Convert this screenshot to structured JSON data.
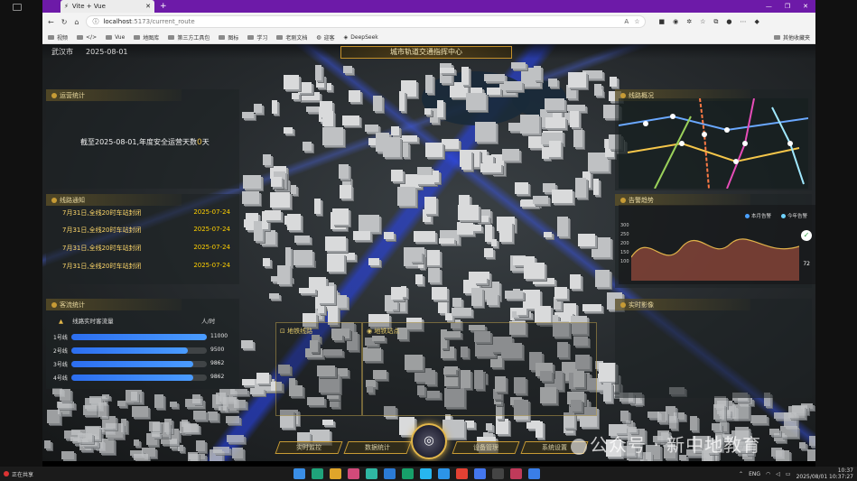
{
  "browser": {
    "tab_title": "Vite + Vue",
    "url_host": "localhost",
    "url_path": ":5173/current_route",
    "bookmarks": [
      "视频",
      "</>",
      "Vue",
      "地图库",
      "第三方工具包",
      "图标",
      "学习",
      "老刚文档",
      "迎客",
      "DeepSeek"
    ],
    "bookmarks_right": "其他收藏夹"
  },
  "dashboard": {
    "city": "武汉市",
    "date": "2025-08-01",
    "title": "城市轨道交通指挥中心",
    "panels": {
      "safety": "运营统计",
      "notice": "线路通知",
      "flow": "客流统计",
      "metro": "线路概况",
      "alarm": "告警趋势",
      "media": "实时影像",
      "lines": "地铁线路",
      "stations": "地铁站点"
    },
    "safety_text": "截至2025-08-01,年度安全运营天数",
    "safety_days": "0",
    "safety_unit": "天",
    "notices": [
      {
        "text": "7月31日,全线20时车站封闭",
        "date": "2025-07-24"
      },
      {
        "text": "7月31日,全线20时车站封闭",
        "date": "2025-07-24"
      },
      {
        "text": "7月31日,全线20时车站封闭",
        "date": "2025-07-24"
      },
      {
        "text": "7月31日,全线20时车站封闭",
        "date": "2025-07-24"
      }
    ],
    "flow_header": {
      "label": "线路实时客流量",
      "unit": "人/时"
    },
    "flow_rows": [
      {
        "name": "1号线",
        "value": 11000,
        "ratio": 1.0
      },
      {
        "name": "2号线",
        "value": 9500,
        "ratio": 0.86
      },
      {
        "name": "3号线",
        "value": 9862,
        "ratio": 0.9
      },
      {
        "name": "4号线",
        "value": 9862,
        "ratio": 0.9
      }
    ],
    "chart_legend": [
      "本月告警",
      "今年告警"
    ],
    "chart_yticks": [
      "300",
      "250",
      "200",
      "150",
      "100"
    ],
    "chart_pct": "72",
    "bottom_nav": [
      "实时监控",
      "数据统计",
      "设备管理",
      "系统设置"
    ],
    "watermark": "公众号 · 新中地教育"
  },
  "taskbar": {
    "share_text": "正在共享",
    "time": "10:37",
    "datetime": "2025/08/01 10:37:27",
    "lang": "ENG"
  },
  "colors": {
    "title_bar": "#6d1aa8",
    "accent_gold": "#c79b35",
    "bar_blue": "#2c6ef0"
  }
}
